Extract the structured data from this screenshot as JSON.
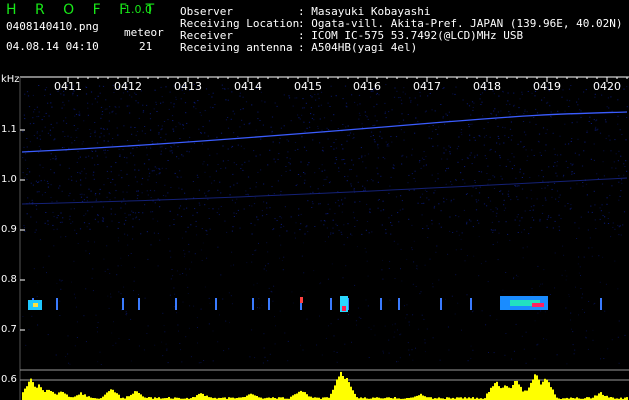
{
  "app": {
    "title": "H R O F F T",
    "version": "1.0.0",
    "file": "0408140410.png",
    "datetime": "04.08.14 04:10",
    "meteor_label": "meteor",
    "meteor_count": "21"
  },
  "info": {
    "observer_label": "Observer",
    "observer_value": ": Masayuki Kobayashi",
    "location_label": "Receiving Location",
    "location_value": ": Ogata-vill. Akita-Pref. JAPAN (139.96E, 40.02N)",
    "receiver_label": "Receiver",
    "receiver_value": ": ICOM IC-575 53.7492(@LCD)MHz USB",
    "antenna_label": "Receiving antenna",
    "antenna_value": ": A504HB(yagi 4el)"
  },
  "axis": {
    "unit": "kHz",
    "y_ticks": [
      "1.1",
      "1.0",
      "0.9",
      "0.8",
      "0.7",
      "0.6"
    ],
    "x_ticks": [
      "0411",
      "0412",
      "0413",
      "0414",
      "0415",
      "0416",
      "0417",
      "0418",
      "0419",
      "0420"
    ]
  },
  "colors": {
    "background": "#000000",
    "title_green": "#18e818",
    "axis_tick": "#ffffff",
    "echo_line": "#3a5cff",
    "noise_blue": "#0a1a7a",
    "baseline": "#9a9a9a",
    "activity": "#ffff00"
  }
}
